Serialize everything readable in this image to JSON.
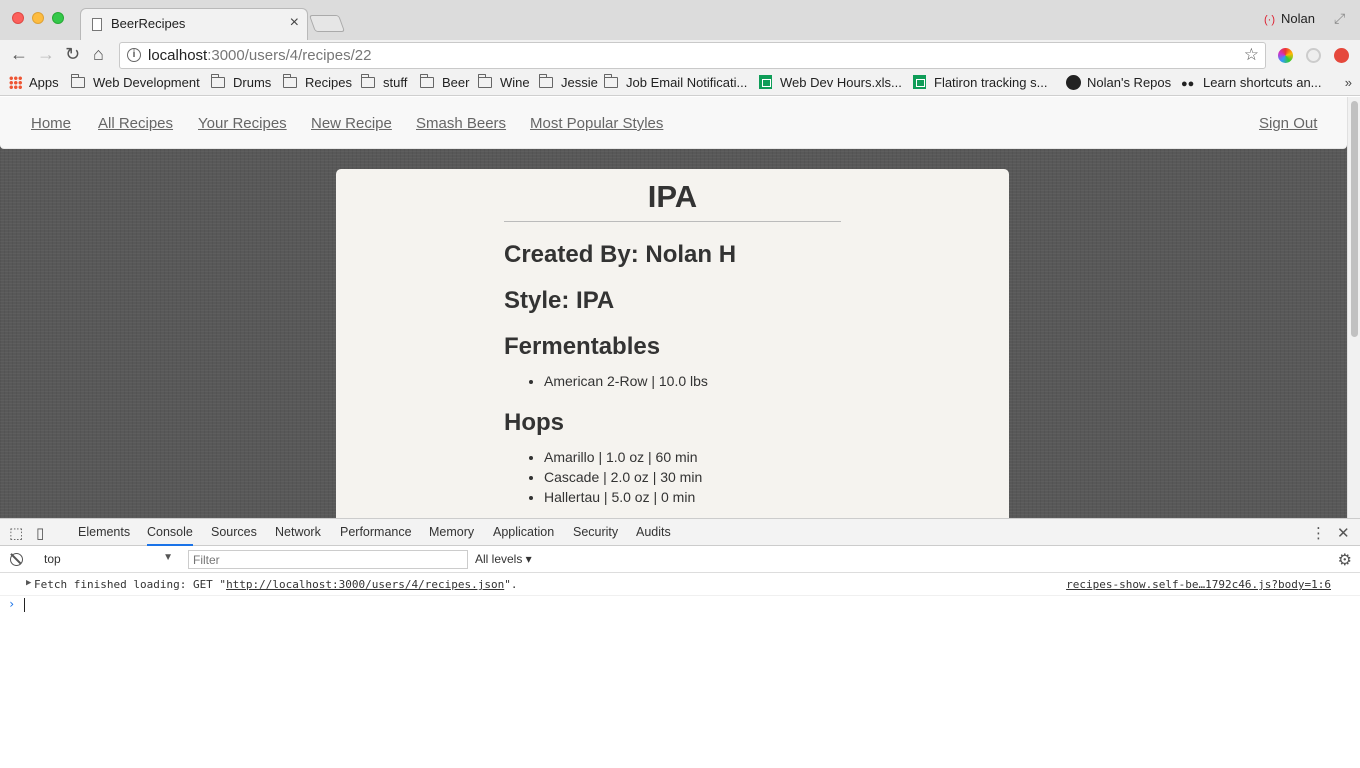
{
  "browser": {
    "tab_title": "BeerRecipes",
    "tab_close": "×",
    "profile_name": "Nolan",
    "url_host": "localhost",
    "url_path": ":3000/users/4/recipes/22",
    "back": "←",
    "forward": "→",
    "reload": "↻",
    "home": "⌂",
    "star": "☆"
  },
  "bookmarks": [
    {
      "label": "Apps",
      "icon": "apps-grid-icon"
    },
    {
      "label": "Web Development",
      "icon": "folder-icon"
    },
    {
      "label": "Drums",
      "icon": "folder-icon"
    },
    {
      "label": "Recipes",
      "icon": "folder-icon"
    },
    {
      "label": "stuff",
      "icon": "folder-icon"
    },
    {
      "label": "Beer",
      "icon": "folder-icon"
    },
    {
      "label": "Wine",
      "icon": "folder-icon"
    },
    {
      "label": "Jessie",
      "icon": "folder-icon"
    },
    {
      "label": "Job Email Notificati...",
      "icon": "folder-icon"
    },
    {
      "label": "Web Dev Hours.xls...",
      "icon": "sheets-icon"
    },
    {
      "label": "Flatiron tracking s...",
      "icon": "sheets-icon"
    },
    {
      "label": "Nolan's Repos",
      "icon": "github-icon"
    },
    {
      "label": "Learn shortcuts an...",
      "icon": "mask-icon"
    }
  ],
  "bookmarks_more": "»",
  "site_nav": {
    "home": "Home",
    "all_recipes": "All Recipes",
    "your_recipes": "Your Recipes",
    "new_recipe": "New Recipe",
    "smash_beers": "Smash Beers",
    "most_popular": "Most Popular Styles",
    "sign_out": "Sign Out"
  },
  "recipe": {
    "title": "IPA",
    "created_by": "Created By: Nolan H",
    "style": "Style: IPA",
    "fermentables_heading": "Fermentables",
    "fermentables": [
      "American 2-Row | 10.0 lbs"
    ],
    "hops_heading": "Hops",
    "hops": [
      "Amarillo | 1.0 oz | 60 min",
      "Cascade | 2.0 oz | 30 min",
      "Hallertau | 5.0 oz | 0 min"
    ]
  },
  "devtools": {
    "tabs": [
      "Elements",
      "Console",
      "Sources",
      "Network",
      "Performance",
      "Memory",
      "Application",
      "Security",
      "Audits"
    ],
    "active_tab": "Console",
    "context": "top",
    "filter_placeholder": "Filter",
    "levels": "All levels ▾",
    "message_prefix": "Fetch finished loading: GET \"",
    "message_url": "http://localhost:3000/users/4/recipes.json",
    "message_suffix": "\".",
    "message_source": "recipes-show.self-be…1792c46.js?body=1:6",
    "prompt": "›"
  }
}
